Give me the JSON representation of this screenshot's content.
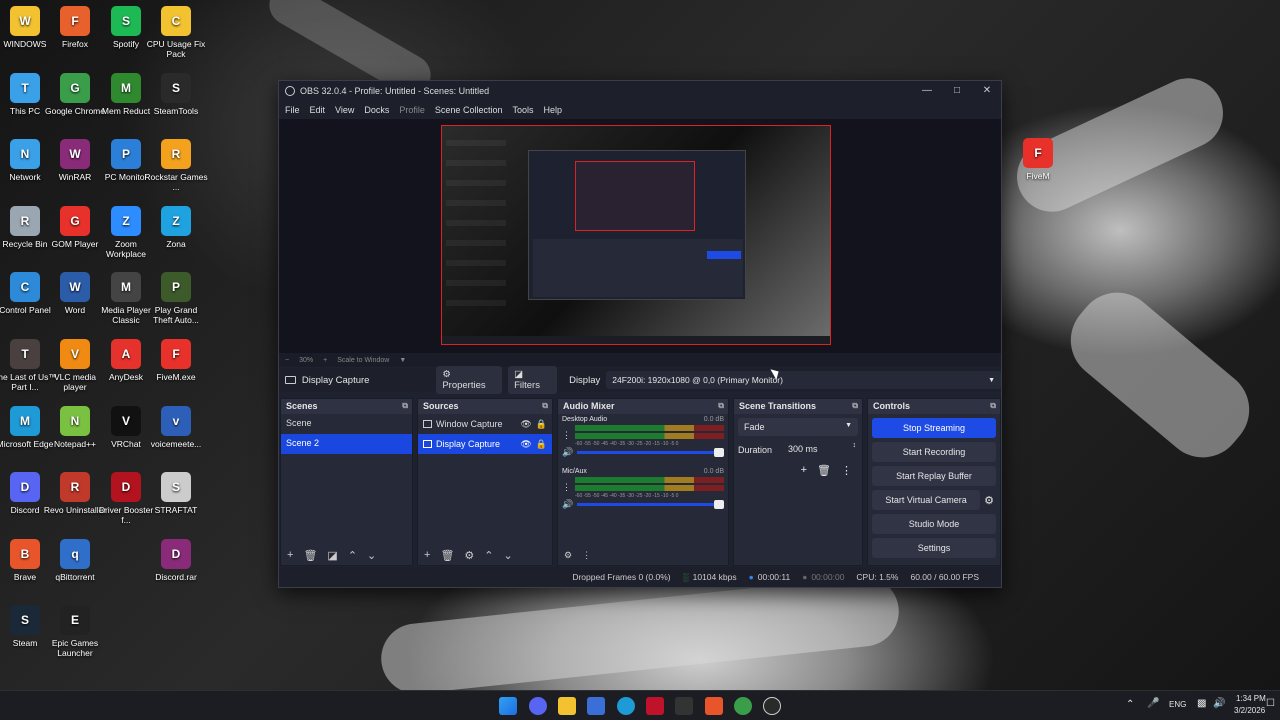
{
  "desktop_icons": [
    {
      "label": "WINDOWS",
      "icon": "folder-icon",
      "color": "#f2c230"
    },
    {
      "label": "This PC",
      "icon": "computer-icon",
      "color": "#3aa0e8"
    },
    {
      "label": "Network",
      "icon": "network-icon",
      "color": "#3aa0e8"
    },
    {
      "label": "Recycle Bin",
      "icon": "recycle-bin-icon",
      "color": "#9aa7b3"
    },
    {
      "label": "Control Panel",
      "icon": "control-panel-icon",
      "color": "#2d8ad8"
    },
    {
      "label": "The Last of Us™ Part I...",
      "icon": "game-icon",
      "color": "#4a4040"
    },
    {
      "label": "Microsoft Edge",
      "icon": "edge-icon",
      "color": "#1e9ad6"
    },
    {
      "label": "Discord",
      "icon": "discord-icon",
      "color": "#5865f2"
    },
    {
      "label": "Brave",
      "icon": "brave-icon",
      "color": "#e8552a"
    },
    {
      "label": "Steam",
      "icon": "steam-icon",
      "color": "#1b2838"
    },
    {
      "label": "Firefox",
      "icon": "firefox-icon",
      "color": "#e8612c"
    },
    {
      "label": "Google Chrome",
      "icon": "chrome-icon",
      "color": "#3a9d4a"
    },
    {
      "label": "WinRAR",
      "icon": "winrar-icon",
      "color": "#8a2b7a"
    },
    {
      "label": "GOM Player",
      "icon": "gom-icon",
      "color": "#e8312a"
    },
    {
      "label": "Word",
      "icon": "word-icon",
      "color": "#2b5ca8"
    },
    {
      "label": "VLC media player",
      "icon": "vlc-icon",
      "color": "#f08a12"
    },
    {
      "label": "Notepad++",
      "icon": "notepad-icon",
      "color": "#7ac142"
    },
    {
      "label": "Revo Uninstaller",
      "icon": "revo-icon",
      "color": "#c0392b"
    },
    {
      "label": "qBittorrent",
      "icon": "qbittorrent-icon",
      "color": "#2f6fc9"
    },
    {
      "label": "Epic Games Launcher",
      "icon": "epic-icon",
      "color": "#222222"
    },
    {
      "label": "Spotify",
      "icon": "spotify-icon",
      "color": "#1db954"
    },
    {
      "label": "Mem Reduct",
      "icon": "mem-reduct-icon",
      "color": "#2f8a2f"
    },
    {
      "label": "PC Monitor",
      "icon": "pc-monitor-icon",
      "color": "#2c7fd8"
    },
    {
      "label": "Zoom Workplace",
      "icon": "zoom-icon",
      "color": "#2d8cff"
    },
    {
      "label": "Media Player Classic",
      "icon": "mpc-icon",
      "color": "#444444"
    },
    {
      "label": "AnyDesk",
      "icon": "anydesk-icon",
      "color": "#e5322d"
    },
    {
      "label": "VRChat",
      "icon": "vrchat-icon",
      "color": "#111111"
    },
    {
      "label": "Driver Booster f...",
      "icon": "driver-booster-icon",
      "color": "#b3121f"
    },
    {
      "label": "CPU Usage Fix Pack",
      "icon": "folder-icon",
      "color": "#f2c230"
    },
    {
      "label": "SteamTools",
      "icon": "steamtools-icon",
      "color": "#2a2a2a"
    },
    {
      "label": "Rockstar Games ...",
      "icon": "rockstar-icon",
      "color": "#f4a21d"
    },
    {
      "label": "Zona",
      "icon": "zona-icon",
      "color": "#1fa3e0"
    },
    {
      "label": "Play Grand Theft Auto...",
      "icon": "gta-icon",
      "color": "#3c5a2a"
    },
    {
      "label": "FiveM.exe",
      "icon": "fivem-icon",
      "color": "#e8312a"
    },
    {
      "label": "voicemeete...",
      "icon": "voicemeeter-icon",
      "color": "#2e5fb8"
    },
    {
      "label": "STRAFTAT",
      "icon": "straftat-icon",
      "color": "#cccccc"
    },
    {
      "label": "Discord.rar",
      "icon": "winrar-icon",
      "color": "#8a2b7a"
    },
    {
      "label": "FiveM",
      "icon": "fivem-icon",
      "color": "#e8312a"
    }
  ],
  "obs": {
    "title": "OBS 32.0.4 - Profile: Untitled - Scenes: Untitled",
    "menu": [
      "File",
      "Edit",
      "View",
      "Docks",
      "Profile",
      "Scene Collection",
      "Tools",
      "Help"
    ],
    "zoom": {
      "minus": "−",
      "value": "30%",
      "plus": "+",
      "mode": "Scale to Window"
    },
    "source_bar": {
      "selected_source": "Display Capture",
      "properties": "Properties",
      "filters": "Filters",
      "display_label": "Display",
      "display_value": "24F200i: 1920x1080 @ 0,0 (Primary Monitor)"
    },
    "scenes": {
      "title": "Scenes",
      "items": [
        "Scene",
        "Scene 2"
      ],
      "selected": 1
    },
    "sources": {
      "title": "Sources",
      "items": [
        "Window Capture",
        "Display Capture"
      ],
      "selected": 1
    },
    "mixer": {
      "title": "Audio Mixer",
      "channels": [
        {
          "name": "Desktop Audio",
          "db": "0.0 dB"
        },
        {
          "name": "Mic/Aux",
          "db": "0.0 dB"
        }
      ],
      "scale": "-60 -55 -50 -45 -40 -35 -30 -25 -20 -15 -10 -5 0"
    },
    "transitions": {
      "title": "Scene Transitions",
      "type": "Fade",
      "duration_label": "Duration",
      "duration_value": "300 ms"
    },
    "controls": {
      "title": "Controls",
      "buttons": [
        "Stop Streaming",
        "Start Recording",
        "Start Replay Buffer",
        "Start Virtual Camera",
        "Studio Mode",
        "Settings"
      ]
    },
    "status": {
      "dropped": "Dropped Frames 0 (0.0%)",
      "bitrate": "10104 kbps",
      "stream_time": "00:00:11",
      "rec_time": "00:00:00",
      "cpu": "CPU: 1.5%",
      "fps": "60.00 / 60.00 FPS"
    }
  },
  "taskbar": {
    "lang": "ENG",
    "time": "1:34 PM",
    "date": "3/2/2026"
  },
  "colors": {
    "accent": "#1e4be6",
    "panel": "#262a38",
    "window": "#1e2130"
  }
}
